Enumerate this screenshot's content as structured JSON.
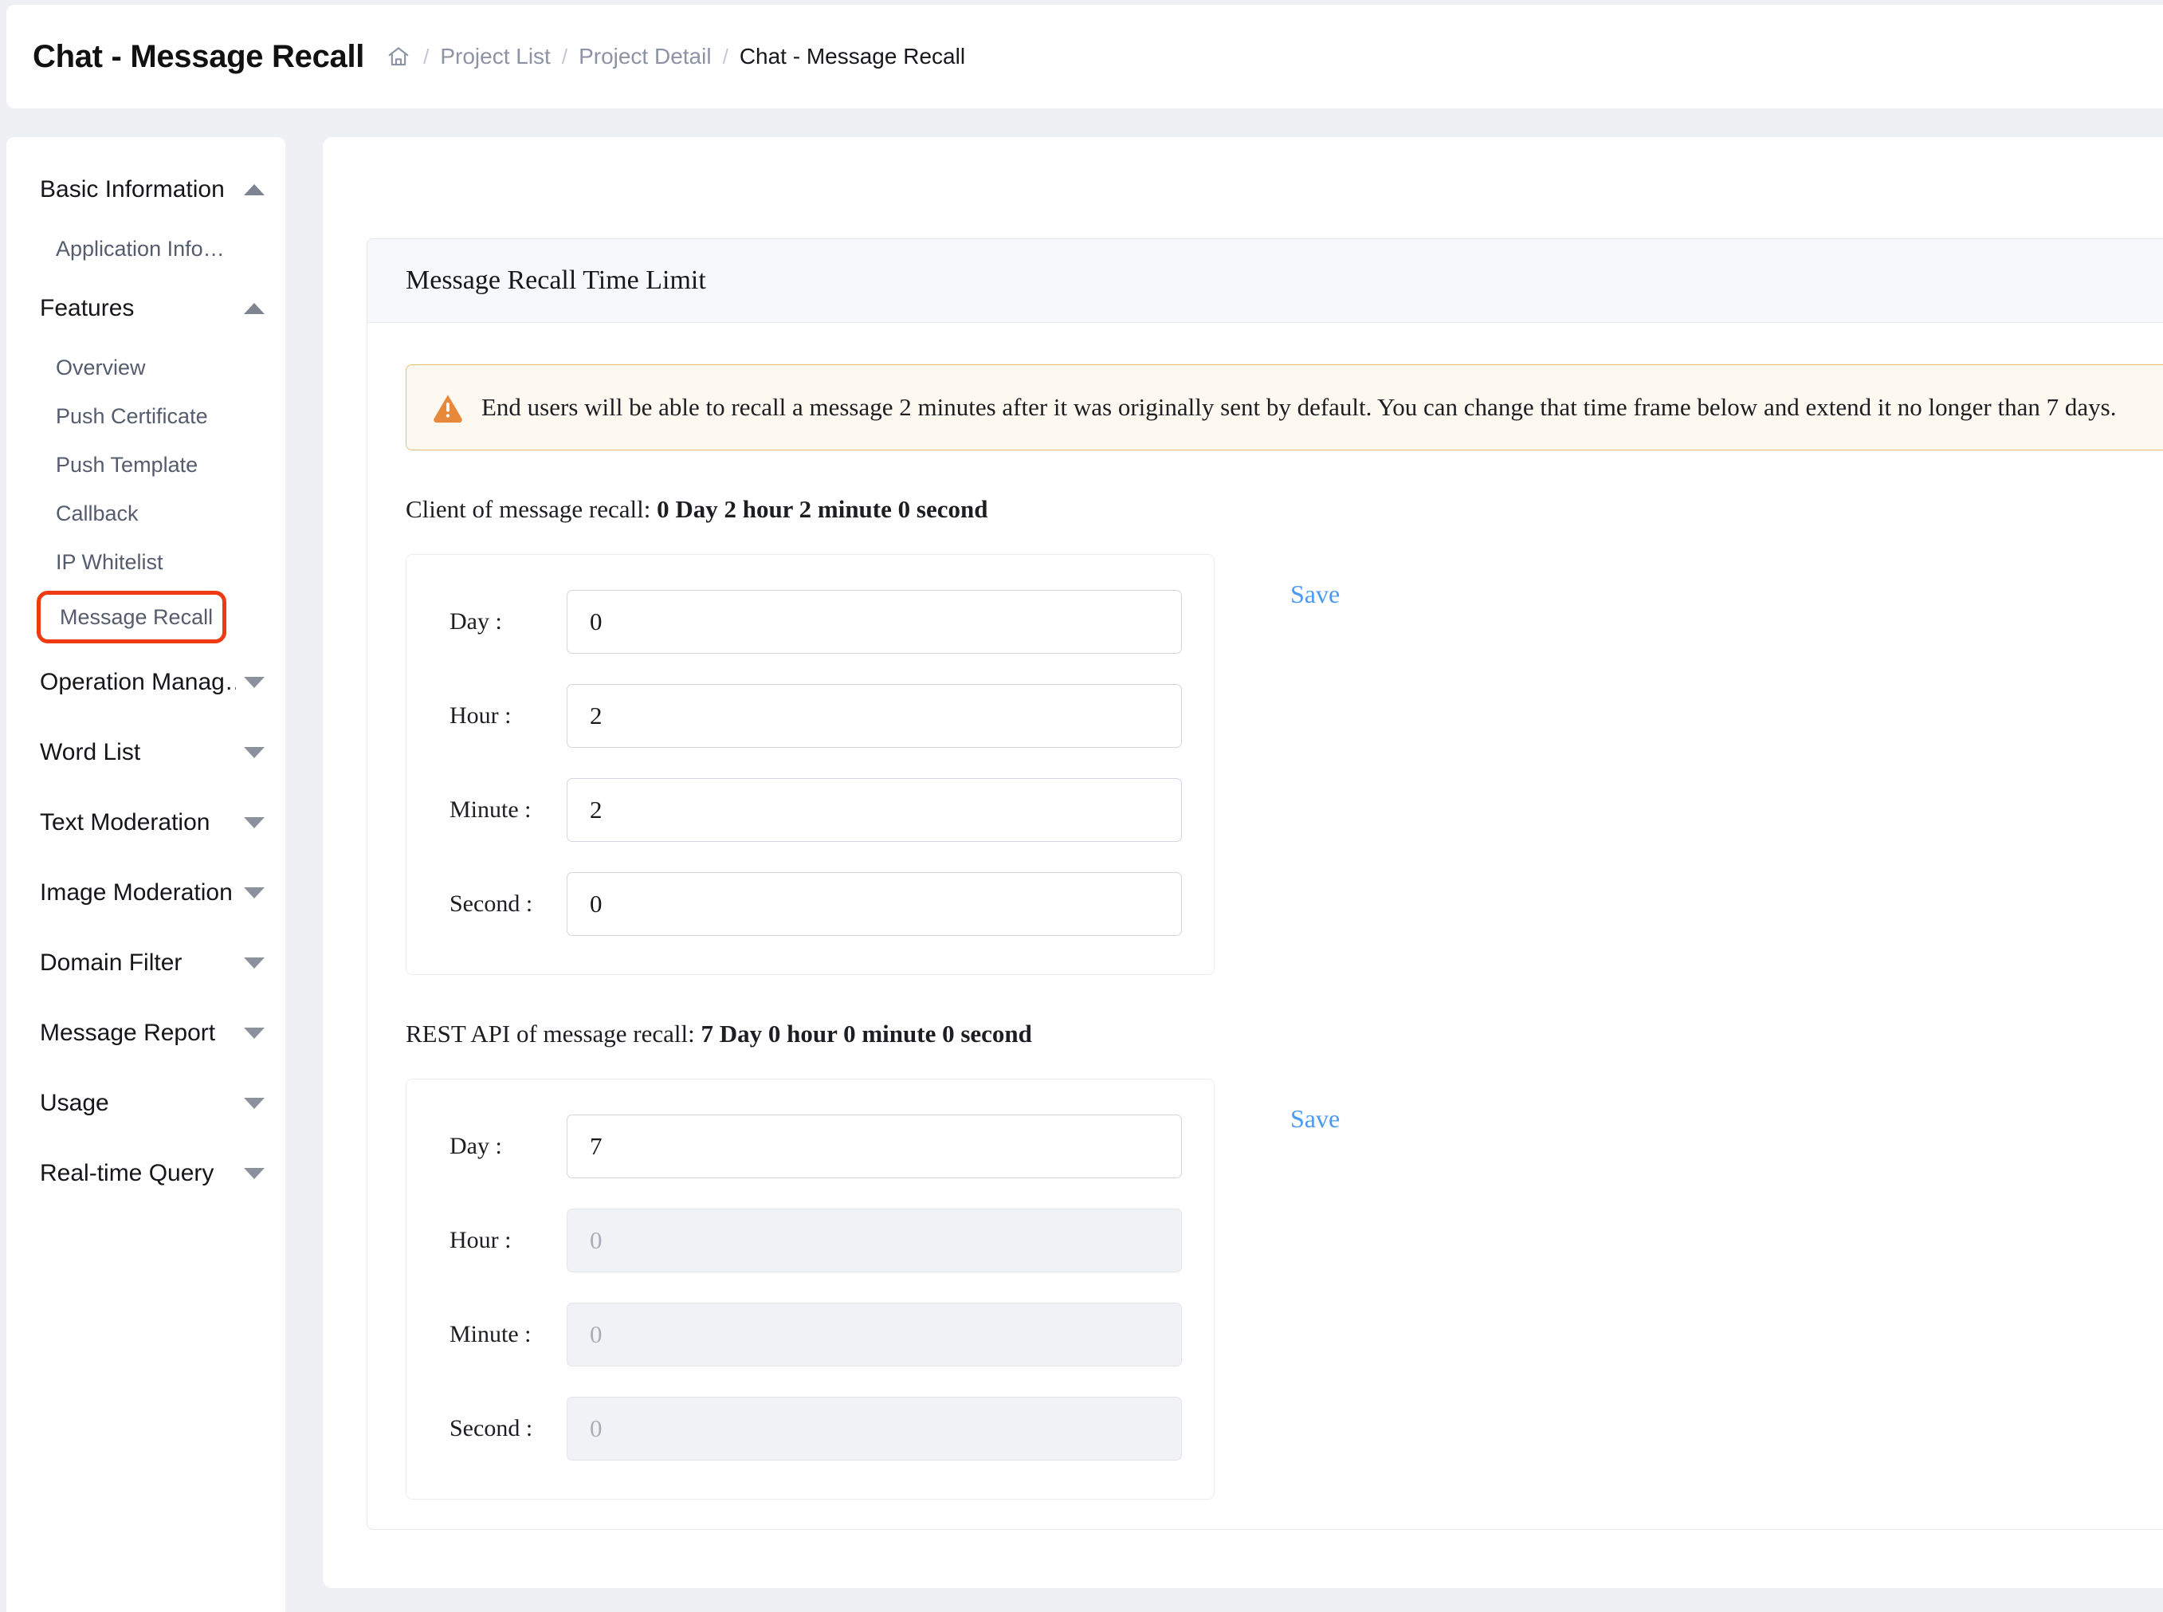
{
  "header": {
    "title": "Chat - Message Recall",
    "breadcrumb": {
      "home_icon": "home-icon",
      "sep": "/",
      "items": [
        {
          "label": "Project List",
          "current": false
        },
        {
          "label": "Project Detail",
          "current": false
        },
        {
          "label": "Chat - Message Recall",
          "current": true
        }
      ]
    }
  },
  "sidebar": {
    "groups": [
      {
        "label": "Basic Information",
        "caret": "up",
        "items": [
          {
            "label": "Application Info…",
            "highlighted": false
          }
        ]
      },
      {
        "label": "Features",
        "caret": "up",
        "items": [
          {
            "label": "Overview",
            "highlighted": false
          },
          {
            "label": "Push Certificate",
            "highlighted": false
          },
          {
            "label": "Push Template",
            "highlighted": false
          },
          {
            "label": "Callback",
            "highlighted": false
          },
          {
            "label": "IP Whitelist",
            "highlighted": false
          },
          {
            "label": "Message Recall",
            "highlighted": true
          }
        ]
      },
      {
        "label": "Operation Manag…",
        "caret": "down",
        "items": []
      },
      {
        "label": "Word List",
        "caret": "down",
        "items": []
      },
      {
        "label": "Text Moderation",
        "caret": "down",
        "items": []
      },
      {
        "label": "Image Moderation",
        "caret": "down",
        "items": []
      },
      {
        "label": "Domain Filter",
        "caret": "down",
        "items": []
      },
      {
        "label": "Message Report",
        "caret": "down",
        "items": []
      },
      {
        "label": "Usage",
        "caret": "down",
        "items": []
      },
      {
        "label": "Real-time Query",
        "caret": "down",
        "items": []
      }
    ]
  },
  "panel": {
    "title": "Message Recall Time Limit",
    "alert": {
      "icon": "warning-triangle-icon",
      "text": "End users will be able to recall a message 2 minutes after it was originally sent by default. You can change that time frame below and extend it no longer than 7 days."
    },
    "sections": [
      {
        "heading_prefix": "Client of message recall: ",
        "heading_value": "0 Day 2 hour 2 minute 0 second",
        "save_label": "Save",
        "fields": [
          {
            "label": "Day :",
            "value": "0",
            "placeholder": "",
            "disabled": false
          },
          {
            "label": "Hour :",
            "value": "2",
            "placeholder": "",
            "disabled": false
          },
          {
            "label": "Minute :",
            "value": "2",
            "placeholder": "",
            "disabled": false
          },
          {
            "label": "Second :",
            "value": "0",
            "placeholder": "",
            "disabled": false
          }
        ]
      },
      {
        "heading_prefix": "REST API of message recall: ",
        "heading_value": "7 Day 0 hour 0 minute 0 second",
        "save_label": "Save",
        "fields": [
          {
            "label": "Day :",
            "value": "7",
            "placeholder": "",
            "disabled": false
          },
          {
            "label": "Hour :",
            "value": "",
            "placeholder": "0",
            "disabled": true
          },
          {
            "label": "Minute :",
            "value": "",
            "placeholder": "0",
            "disabled": true
          },
          {
            "label": "Second :",
            "value": "",
            "placeholder": "0",
            "disabled": true
          }
        ]
      }
    ]
  },
  "colors": {
    "page_bg": "#eef0f3",
    "accent_link": "#4a9af5",
    "highlight_box": "#ef3a12",
    "alert_bg": "#fdf8f0",
    "alert_border": "#e6c07b",
    "warn_icon": "#e8883a"
  }
}
